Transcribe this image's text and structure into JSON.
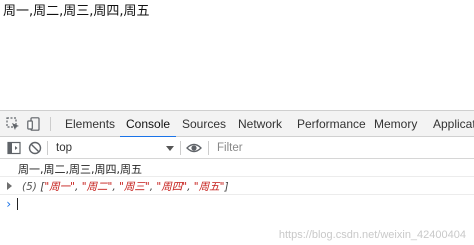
{
  "page": {
    "output_text": "周一,周二,周三,周四,周五"
  },
  "devtools": {
    "tabs": [
      {
        "label": "Elements"
      },
      {
        "label": "Console"
      },
      {
        "label": "Sources"
      },
      {
        "label": "Network"
      },
      {
        "label": "Performance"
      },
      {
        "label": "Memory"
      },
      {
        "label": "Applicatio"
      }
    ],
    "active_tab": "Console",
    "accent_color": "#1a73e8",
    "icons": [
      "inspect-element-icon",
      "device-toolbar-icon",
      "clear-console-icon",
      "eye-icon"
    ],
    "toolbar": {
      "context": "top",
      "filter_placeholder": "Filter"
    },
    "console": {
      "log_line": "周一,周二,周三,周四,周五",
      "array_length": "(5)",
      "array_open": "[",
      "array_close": "]",
      "array_sep": ", ",
      "array_items": [
        "\"周一\"",
        "\"周二\"",
        "\"周三\"",
        "\"周四\"",
        "\"周五\""
      ],
      "string_color": "#c41a16",
      "prompt": "›"
    }
  },
  "watermark": "https://blog.csdn.net/weixin_42400404"
}
